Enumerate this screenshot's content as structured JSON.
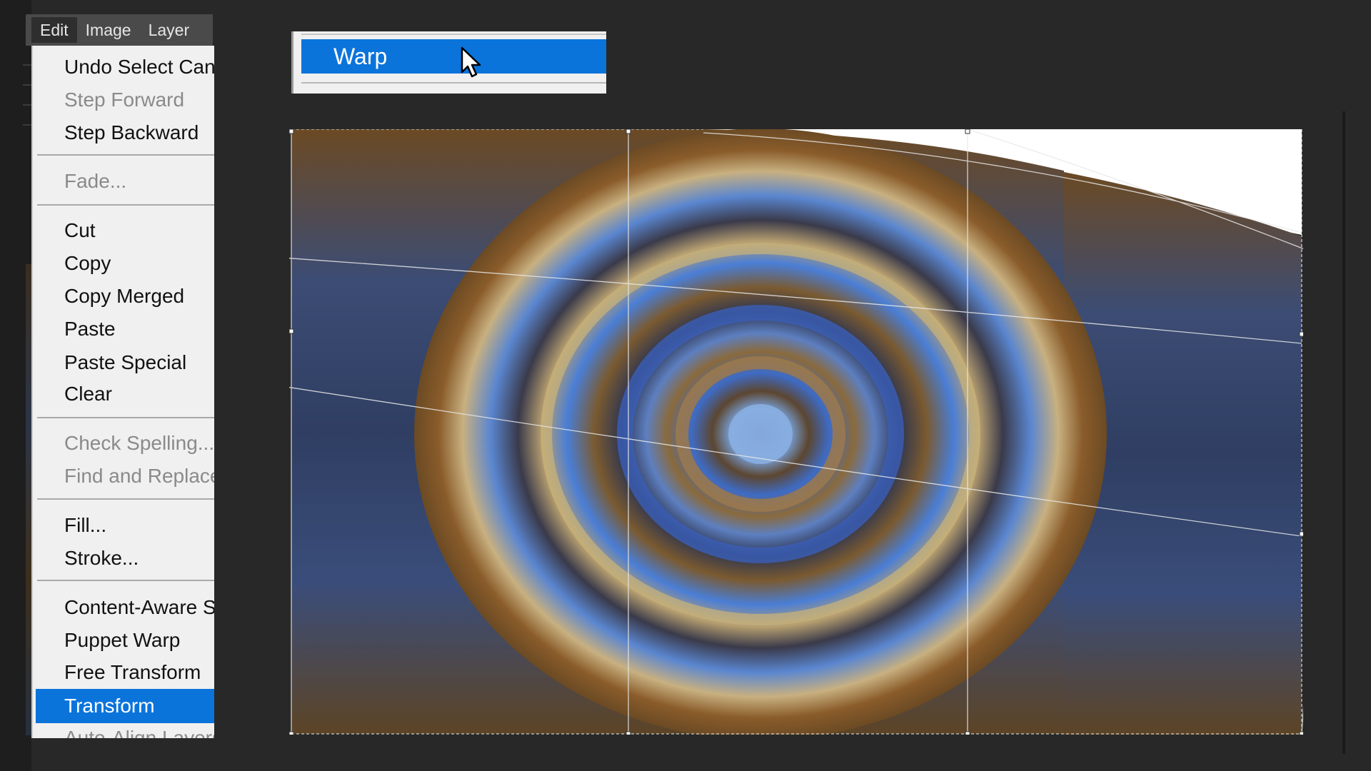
{
  "menubar": {
    "items": [
      {
        "label": "Edit",
        "active": true
      },
      {
        "label": "Image",
        "active": false
      },
      {
        "label": "Layer",
        "active": false
      }
    ]
  },
  "edit_menu": {
    "items": [
      {
        "label": "Undo Select Canvas",
        "enabled": true
      },
      {
        "label": "Step Forward",
        "enabled": false
      },
      {
        "label": "Step Backward",
        "enabled": true
      },
      {
        "label": "Fade...",
        "enabled": false
      },
      {
        "label": "Cut",
        "enabled": true
      },
      {
        "label": "Copy",
        "enabled": true
      },
      {
        "label": "Copy Merged",
        "enabled": true
      },
      {
        "label": "Paste",
        "enabled": true
      },
      {
        "label": "Paste Special",
        "enabled": true
      },
      {
        "label": "Clear",
        "enabled": true
      },
      {
        "label": "Check Spelling...",
        "enabled": false
      },
      {
        "label": "Find and Replace Text...",
        "enabled": false
      },
      {
        "label": "Fill...",
        "enabled": true
      },
      {
        "label": "Stroke...",
        "enabled": true
      },
      {
        "label": "Content-Aware Scale",
        "enabled": true
      },
      {
        "label": "Puppet Warp",
        "enabled": true
      },
      {
        "label": "Free Transform",
        "enabled": true
      },
      {
        "label": "Transform",
        "enabled": true,
        "highlighted": true
      },
      {
        "label": "Auto-Align Layers...",
        "enabled": false
      }
    ]
  },
  "transform_submenu": {
    "items": [
      {
        "label": "Warp",
        "highlighted": true
      }
    ]
  },
  "colors": {
    "highlight": "#0a74db",
    "menu_bg": "#f0f0f0",
    "app_bg": "#282828"
  }
}
